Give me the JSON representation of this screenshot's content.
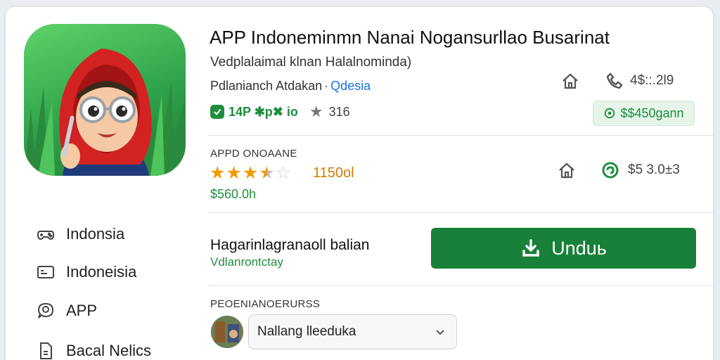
{
  "app": {
    "title": "APP Indoneminmn Nanai Nogansurllao Busarinat",
    "subtitle": "Vedplalaimal klnan Halalnominda)",
    "developer": "Pdlanianch Atdakan",
    "developer_link": "Qdesia",
    "badge_text": "14P ✱p✖ io",
    "rating": "316"
  },
  "header_right": {
    "row1_value": "4$::.2l9",
    "price_chip": "$$450gann"
  },
  "details": {
    "caption": "APPD ONOAANE",
    "stars": 3.5,
    "stars_count": "1150ol",
    "price": "$560.0h",
    "row2_value": "$5 3.0±3"
  },
  "sidebar": {
    "items": [
      {
        "label": "Indonsia",
        "icon": "gamepad-icon"
      },
      {
        "label": "Indoneisia",
        "icon": "id-card-icon"
      },
      {
        "label": "APP",
        "icon": "chat-search-icon"
      },
      {
        "label": "Bacal Nelics",
        "icon": "document-icon"
      }
    ]
  },
  "install": {
    "title": "Hagarinlagranaoll balian",
    "subtitle": "Vdlanrontctay",
    "button_label": "Unduь"
  },
  "reviews": {
    "caption": "PEOENIANOERURSS",
    "selector_value": "Nallang lleeduka"
  },
  "colors": {
    "accent_green": "#188038",
    "star": "#f29900",
    "link": "#1a73e8"
  }
}
